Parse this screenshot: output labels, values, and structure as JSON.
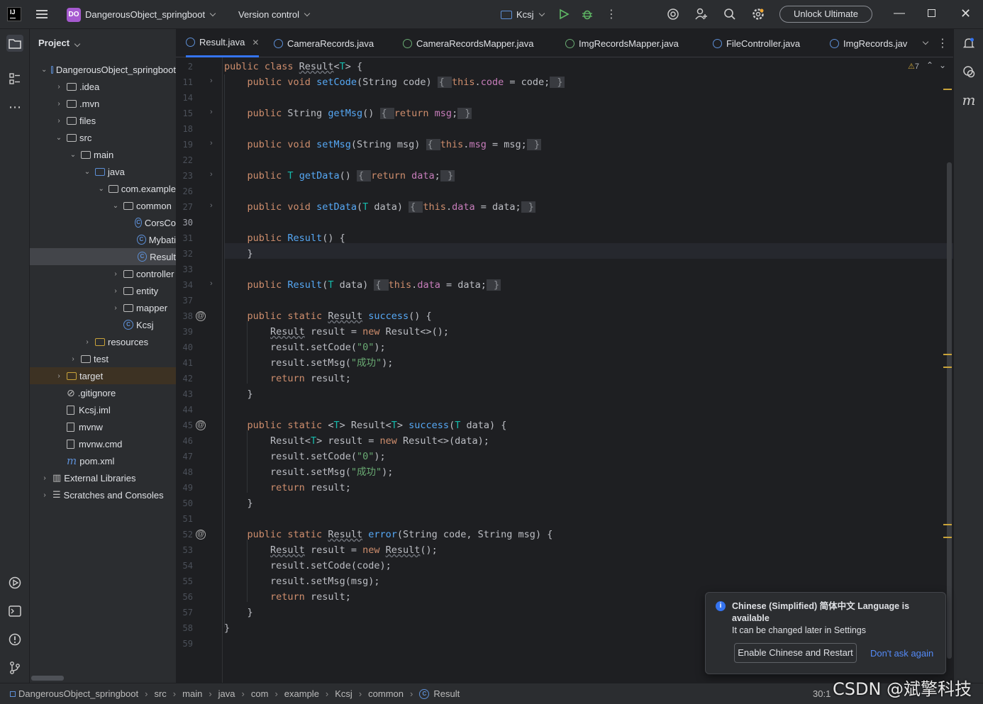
{
  "titlebar": {
    "logo_text": "IJ",
    "project_badge": "DO",
    "project_name": "DangerousObject_springboot",
    "vcs_label": "Version control",
    "run_config": "Kcsj",
    "unlock_label": "Unlock Ultimate"
  },
  "sidebar": {
    "title": "Project",
    "tree": [
      {
        "label": "DangerousObject_springboot",
        "kind": "module",
        "expanded": true
      },
      {
        "label": ".idea",
        "kind": "folder",
        "expanded": false
      },
      {
        "label": ".mvn",
        "kind": "folder",
        "expanded": false
      },
      {
        "label": "files",
        "kind": "folder",
        "expanded": false
      },
      {
        "label": "src",
        "kind": "folder",
        "expanded": true
      },
      {
        "label": "main",
        "kind": "folder",
        "expanded": true
      },
      {
        "label": "java",
        "kind": "folder",
        "expanded": true
      },
      {
        "label": "com.example",
        "kind": "package",
        "expanded": true
      },
      {
        "label": "common",
        "kind": "package",
        "expanded": true
      },
      {
        "label": "CorsCo",
        "kind": "class"
      },
      {
        "label": "Mybati",
        "kind": "class"
      },
      {
        "label": "Result",
        "kind": "class",
        "selected": true
      },
      {
        "label": "controller",
        "kind": "package",
        "expanded": false
      },
      {
        "label": "entity",
        "kind": "package",
        "expanded": false
      },
      {
        "label": "mapper",
        "kind": "package",
        "expanded": false
      },
      {
        "label": "Kcsj",
        "kind": "app-class"
      },
      {
        "label": "resources",
        "kind": "folder",
        "expanded": false
      },
      {
        "label": "test",
        "kind": "folder",
        "expanded": false
      },
      {
        "label": "target",
        "kind": "folder",
        "expanded": false
      },
      {
        "label": ".gitignore",
        "kind": "ignore-file"
      },
      {
        "label": "Kcsj.iml",
        "kind": "file"
      },
      {
        "label": "mvnw",
        "kind": "file"
      },
      {
        "label": "mvnw.cmd",
        "kind": "text-file"
      },
      {
        "label": "pom.xml",
        "kind": "maven-file"
      },
      {
        "label": "External Libraries",
        "kind": "libraries",
        "expanded": false
      },
      {
        "label": "Scratches and Consoles",
        "kind": "scratches",
        "expanded": false
      }
    ]
  },
  "tabs": [
    {
      "label": "Result.java",
      "active": true,
      "closable": true
    },
    {
      "label": "CameraRecords.java"
    },
    {
      "label": "CameraRecordsMapper.java"
    },
    {
      "label": "ImgRecordsMapper.java"
    },
    {
      "label": "FileController.java"
    },
    {
      "label": "ImgRecords.jav"
    }
  ],
  "editor": {
    "warning_count": "7",
    "line_numbers": [
      "2",
      "11",
      "14",
      "15",
      "18",
      "19",
      "22",
      "23",
      "26",
      "27",
      "30",
      "31",
      "32",
      "33",
      "34",
      "37",
      "38",
      "39",
      "40",
      "41",
      "42",
      "43",
      "44",
      "45",
      "46",
      "47",
      "48",
      "49",
      "50",
      "51",
      "52",
      "53",
      "54",
      "55",
      "56",
      "57",
      "58",
      "59"
    ]
  },
  "notification": {
    "title": "Chinese (Simplified) 简体中文 Language is available",
    "body": "It can be changed later in Settings",
    "primary_button": "Enable Chinese and Restart",
    "secondary_link": "Don't ask again"
  },
  "statusbar": {
    "breadcrumbs": [
      "DangerousObject_springboot",
      "src",
      "main",
      "java",
      "com",
      "example",
      "Kcsj",
      "common",
      "Result"
    ],
    "position": "30:1"
  },
  "watermark": "CSDN @斌擎科技"
}
